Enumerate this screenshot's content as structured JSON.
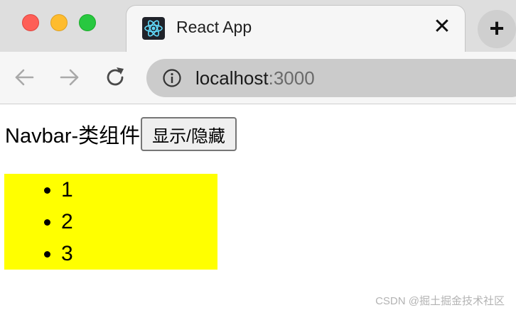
{
  "browser": {
    "tab": {
      "title": "React App",
      "favicon": "react-logo-icon",
      "close_glyph": "✕"
    },
    "new_tab_glyph": "+",
    "address_bar": {
      "host": "localhost",
      "port": ":3000"
    },
    "colors": {
      "traffic_close": "#fe5f57",
      "traffic_minimize": "#febc2e",
      "traffic_maximize": "#28c840",
      "react_logo": "#61dafb"
    }
  },
  "page": {
    "navbar_text": "Navbar-类组件",
    "toggle_button_label": "显示/隐藏",
    "list_items": [
      "1",
      "2",
      "3"
    ],
    "list_background": "#ffff00"
  },
  "watermark": "CSDN @掘土掘金技术社区"
}
